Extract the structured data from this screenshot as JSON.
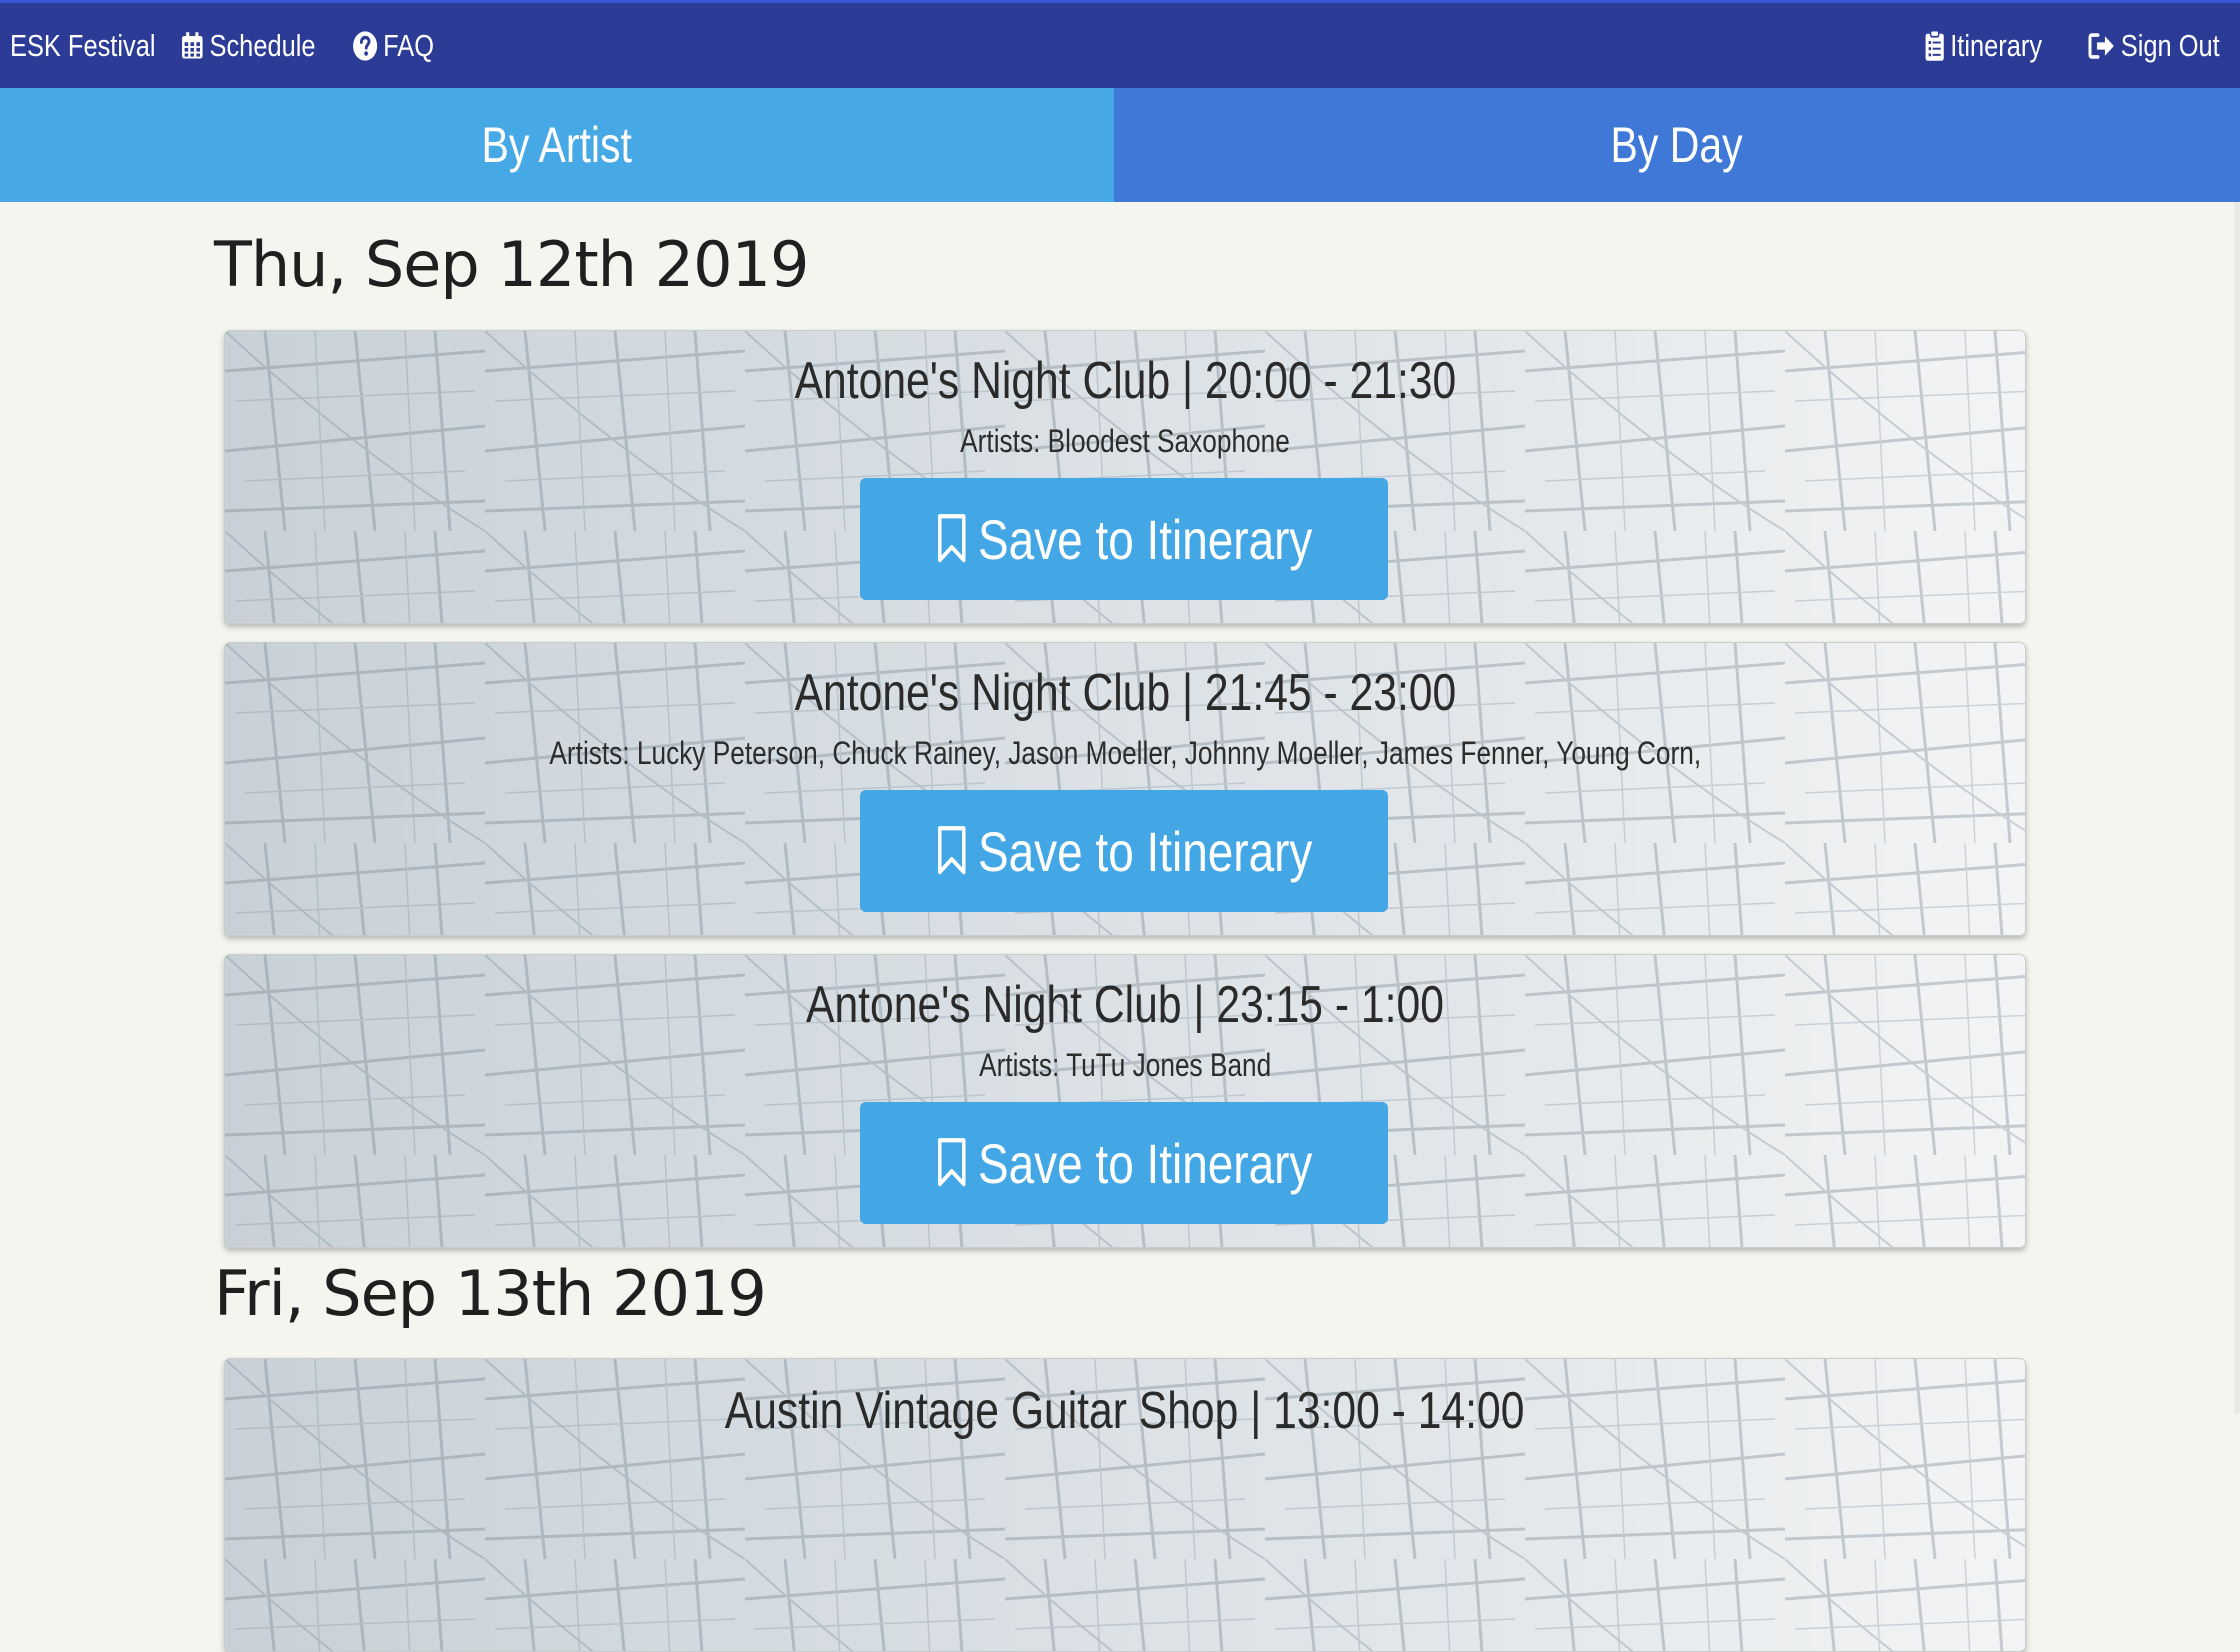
{
  "nav": {
    "brand": "ESK Festival",
    "schedule": "Schedule",
    "faq": "FAQ",
    "itinerary": "Itinerary",
    "sign_out": "Sign Out",
    "icons": {
      "schedule": "calendar-icon",
      "faq": "question-circle-icon",
      "itinerary": "clipboard-icon",
      "sign_out": "sign-out-icon",
      "save": "bookmark-icon"
    }
  },
  "tabs": [
    {
      "label": "By Artist",
      "active": true
    },
    {
      "label": "By Day",
      "active": false
    }
  ],
  "days": [
    {
      "date": "Thu, Sep 12th 2019",
      "events": [
        {
          "title": "Antone's Night Club | 20:00 - 21:30",
          "artists": "Artists: Bloodest Saxophone",
          "button": "Save to Itinerary"
        },
        {
          "title": "Antone's Night Club | 21:45 - 23:00",
          "artists": "Artists: Lucky Peterson, Chuck Rainey, Jason Moeller, Johnny Moeller, James Fenner, Young Corn,",
          "button": "Save to Itinerary"
        },
        {
          "title": "Antone's Night Club | 23:15 - 1:00",
          "artists": "Artists: TuTu Jones Band",
          "button": "Save to Itinerary"
        }
      ]
    },
    {
      "date": "Fri, Sep 13th 2019",
      "events": [
        {
          "title": "Austin Vintage Guitar Shop | 13:00 - 14:00"
        }
      ]
    }
  ],
  "colors": {
    "navbar": "#2c3c96",
    "tab_active": "#47a8e6",
    "tab_inactive": "#3f78d6",
    "button": "#43a6e5",
    "page_bg": "#f4f5ef"
  }
}
